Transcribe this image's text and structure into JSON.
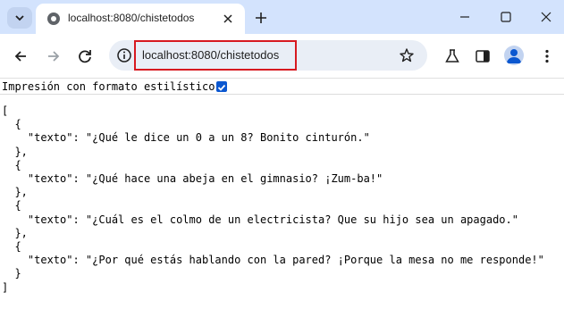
{
  "browser": {
    "tab_title": "localhost:8080/chistetodos",
    "url": "localhost:8080/chistetodos"
  },
  "page": {
    "pretty_print_label": "Impresión con formato estilístico",
    "pretty_print_checked": true,
    "json_lines": [
      "[",
      "  {",
      "    \"texto\": \"¿Qué le dice un 0 a un 8? Bonito cinturón.\"",
      "  },",
      "  {",
      "    \"texto\": \"¿Qué hace una abeja en el gimnasio? ¡Zum-ba!\"",
      "  },",
      "  {",
      "    \"texto\": \"¿Cuál es el colmo de un electricista? Que su hijo sea un apagado.\"",
      "  },",
      "  {",
      "    \"texto\": \"¿Por qué estás hablando con la pared? ¡Porque la mesa no me responde!\"",
      "  }",
      "]"
    ]
  },
  "icons": {
    "tab_search": "chevron-down-icon",
    "favicon": "globe-icon",
    "tab_close": "close-icon",
    "new_tab": "plus-icon",
    "minimize": "minimize-icon",
    "maximize": "maximize-icon",
    "close_window": "close-icon",
    "back": "arrow-left-icon",
    "forward": "arrow-right-icon",
    "reload": "reload-icon",
    "site_info": "info-icon",
    "bookmark": "star-icon",
    "labs": "flask-icon",
    "side_panel": "side-panel-icon",
    "profile": "avatar-icon",
    "menu": "kebab-menu-icon"
  },
  "colors": {
    "tabstrip_bg": "#d3e3fd",
    "omnibox_bg": "#e9eef6",
    "highlight": "#d71920",
    "checkbox": "#0b57d0"
  }
}
